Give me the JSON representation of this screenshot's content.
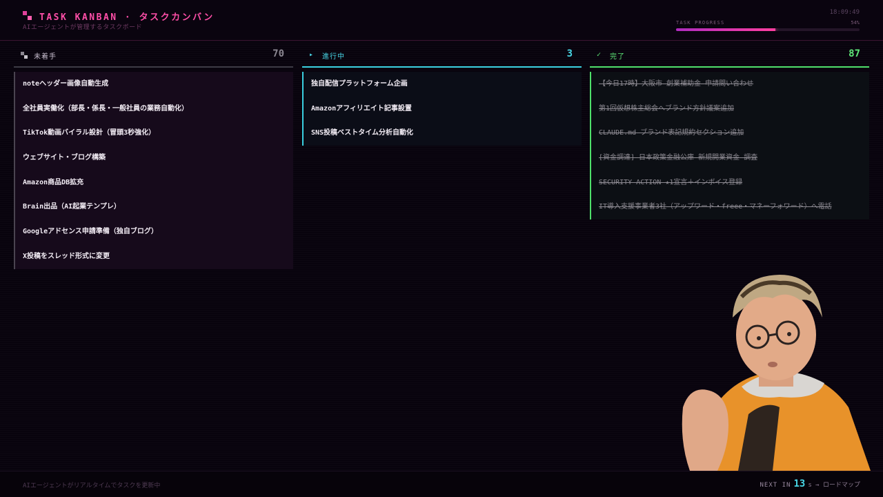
{
  "header": {
    "title": "TASK KANBAN · タスクカンバン",
    "subtitle": "AIエージェントが管理するタスクボード",
    "clock": "18:09:49",
    "progress_label": "TASK PROGRESS",
    "progress_percent_label": "54%",
    "progress_value": 0.54
  },
  "columns": {
    "todo": {
      "icon": "squares-icon",
      "title": "未着手",
      "count": "70",
      "cards": [
        "noteヘッダー画像自動生成",
        "全社員実働化（部長・係長・一般社員の業務自動化）",
        "TikTok動画バイラル設計（冒頭3秒強化）",
        "ウェブサイト・ブログ構築",
        "Amazon商品DB拡充",
        "Brain出品（AI起業テンプレ）",
        "Googleアドセンス申請準備（独自ブログ）",
        "X投稿をスレッド形式に変更"
      ]
    },
    "doing": {
      "icon": "play-icon",
      "icon_glyph": "▸",
      "title": "進行中",
      "count": "3",
      "cards": [
        "独自配信プラットフォーム企画",
        "Amazonアフィリエイト記事設置",
        "SNS投稿ベストタイム分析自動化"
      ]
    },
    "done": {
      "icon": "check-icon",
      "icon_glyph": "✓",
      "title": "完了",
      "count": "87",
      "cards": [
        "【今日17時】大阪市 創業補助金 申請問い合わせ",
        "第1回仮想株主総会へブランド方針議案追加",
        "CLAUDE.md ブランド表記規約セクション追加",
        "[資金調達] 日本政策金融公庫 新規開業資金 調査",
        "SECURITY ACTION ★1宣言＋インボイス登録",
        "IT導入支援事業者3社（アップワード・freee・マネーフォワード）へ電話"
      ]
    }
  },
  "footer": {
    "status": "AIエージェントがリアルタイムでタスクを更新中",
    "next_label": "NEXT IN",
    "seconds": "13",
    "suffix": "s → ロードマップ"
  },
  "colors": {
    "accent_pink": "#ff4fa8",
    "in_progress_cyan": "#48d6e6",
    "done_green": "#5ee878",
    "background": "#08030d"
  }
}
